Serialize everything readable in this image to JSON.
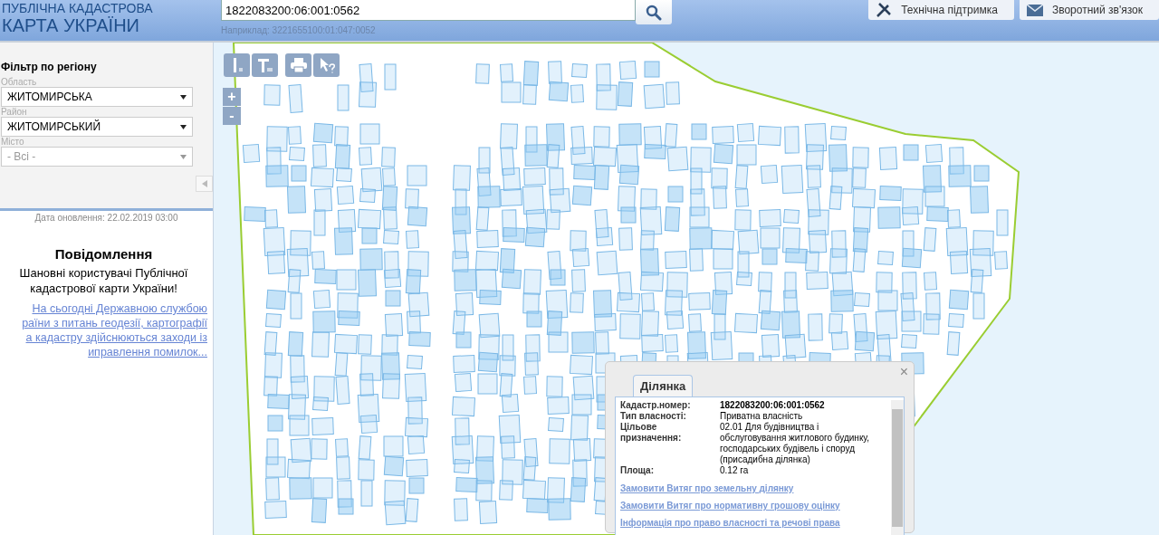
{
  "header": {
    "logo_line_1": "ПУБЛІЧНА КАДАСТРОВА",
    "logo_line_2": "КАРТА УКРАЇНИ",
    "search": {
      "value": "1822083200:06:001:0562",
      "hint": "Наприклад: 3221655100:01:047:0052"
    },
    "buttons": [
      {
        "kind": "support",
        "label": "Технічна підтримка"
      },
      {
        "kind": "feedback",
        "label": "Зворотний зв'язок"
      }
    ]
  },
  "filter": {
    "title": "Фільтр по регіону",
    "fields": [
      {
        "label": "Область",
        "value": "ЖИТОМИРСЬКА",
        "disabled": false
      },
      {
        "label": "Район",
        "value": "ЖИТОМИРСЬКИЙ",
        "disabled": false
      },
      {
        "label": "Місто",
        "value": "- Всі -",
        "disabled": true
      }
    ]
  },
  "update_date": "Дата оновлення: 22.02.2019 03:00",
  "notice": {
    "title": "Повідомлення",
    "greeting": "Шановні користувачі Публічної кадастрової карти України!",
    "link_lines": [
      "На сьогодні Державною службою",
      "раїни з питань геодезії, картографії",
      "а кадастру здійснюються заходи із",
      "иправлення помилок..."
    ]
  },
  "map": {
    "zoom_in": "+",
    "zoom_out": "-"
  },
  "popup": {
    "close": "×",
    "tab": "Ділянка",
    "fields": [
      {
        "kind": "number",
        "label": "Кадастр.номер:",
        "value": "1822083200:06:001:0562"
      },
      {
        "kind": "text",
        "label": "Тип власності:",
        "value": "Приватна власність"
      },
      {
        "kind": "long",
        "label": "Цільове призначення:",
        "value": "02.01 Для будівництва і обслуговування житлового будинку, господарських будівель і споруд (присадибна ділянка)"
      },
      {
        "kind": "text",
        "label": "Площа:",
        "value": "0.12 га"
      }
    ],
    "links": [
      "Замовити Витяг про земельну ділянку",
      "Замовити Витяг про нормативну грошову оцінку",
      "Інформація про право власності та речові права"
    ]
  }
}
